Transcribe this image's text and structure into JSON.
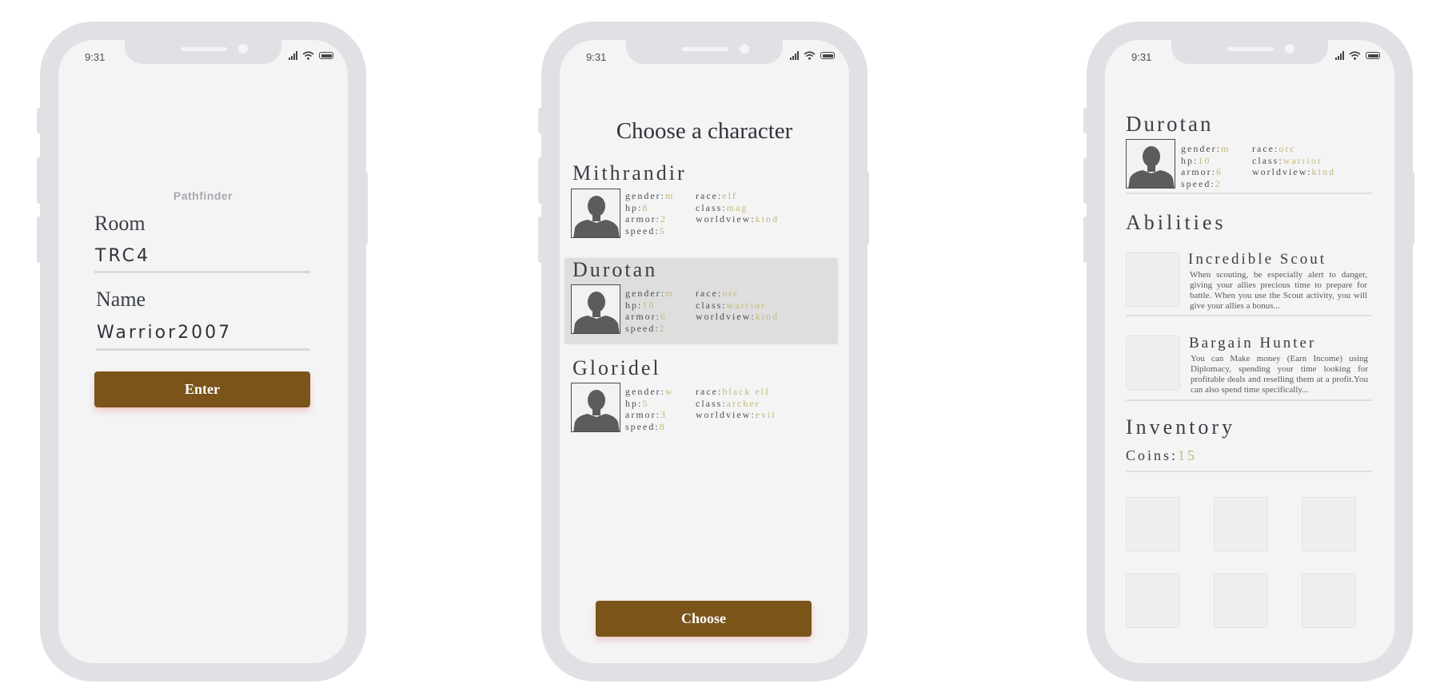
{
  "status_bar": {
    "time": "9:31"
  },
  "login": {
    "app_name": "Pathfinder",
    "room_label": "Room",
    "room_value": "TRC4",
    "name_label": "Name",
    "name_value": "Warrior2007",
    "enter_label": "Enter"
  },
  "choose": {
    "title": "Choose a character",
    "button_label": "Choose",
    "characters": [
      {
        "name": "Mithrandir",
        "gender": "m",
        "hp": "8",
        "armor": "2",
        "speed": "5",
        "race": "elf",
        "class": "mag",
        "worldview": "kind",
        "selected": false
      },
      {
        "name": "Durotan",
        "gender": "m",
        "hp": "10",
        "armor": "6",
        "speed": "2",
        "race": "orc",
        "class": "warrior",
        "worldview": "kind",
        "selected": true
      },
      {
        "name": "Gloridel",
        "gender": "w",
        "hp": "5",
        "armor": "3",
        "speed": "8",
        "race": "black elf",
        "class": "archer",
        "worldview": "evil",
        "selected": false
      }
    ]
  },
  "stat_labels": {
    "gender": "gender:",
    "hp": "hp:",
    "armor": "armor:",
    "speed": "speed:",
    "race": "race:",
    "class": "class:",
    "worldview": "worldview:"
  },
  "profile": {
    "name": "Durotan",
    "gender": "m",
    "hp": "10",
    "armor": "6",
    "speed": "2",
    "race": "orc",
    "class": "warrior",
    "worldview": "kind",
    "abilities_title": "Abilities",
    "abilities": [
      {
        "title": "Incredible Scout",
        "desc": "When scouting, be especially alert to danger, giving your allies precious time to prepare for battle. When you use the Scout activity, you will give your allies a bonus..."
      },
      {
        "title": "Bargain Hunter",
        "desc": "You can Make money (Earn Income) using Diplomacy, spending your time looking for profitable deals and reselling them at a profit.You can also spend time specifically..."
      }
    ],
    "inventory_title": "Inventory",
    "coins_label": "Coins:",
    "coins_value": "15"
  },
  "colors": {
    "accent_button": "#7a5419",
    "stat_value": "#c4b97a",
    "frame": "#dfe1e5",
    "screen": "#f4f4f5"
  }
}
